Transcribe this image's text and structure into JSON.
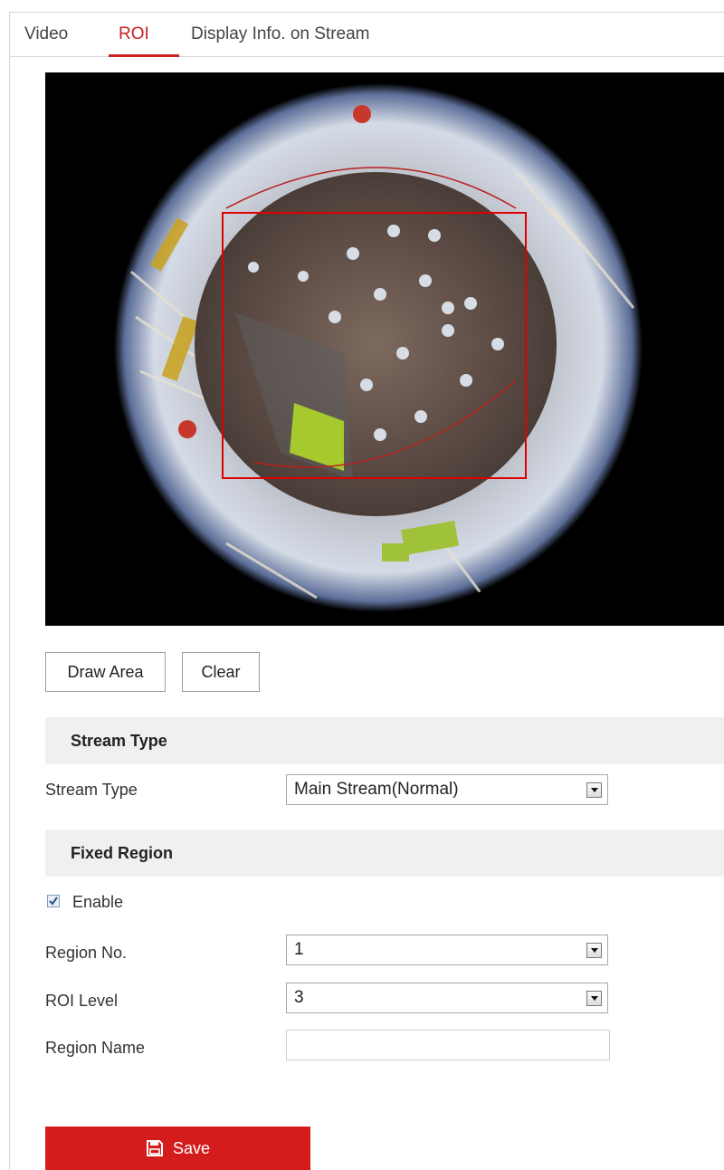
{
  "tabs": [
    {
      "label": "Video",
      "active": false
    },
    {
      "label": "ROI",
      "active": true
    },
    {
      "label": "Display Info. on Stream",
      "active": false
    }
  ],
  "accent_color": "#cc1f1f",
  "video": {
    "roi_rectangle_color": "#e00000"
  },
  "buttons": {
    "draw_area": "Draw Area",
    "clear": "Clear"
  },
  "stream_type_section": {
    "header": "Stream Type",
    "stream_type_label": "Stream Type",
    "stream_type_value": "Main Stream(Normal)"
  },
  "fixed_region_section": {
    "header": "Fixed Region",
    "enable_label": "Enable",
    "enable_checked": true,
    "region_no_label": "Region No.",
    "region_no_value": "1",
    "roi_level_label": "ROI Level",
    "roi_level_value": "3",
    "region_name_label": "Region Name",
    "region_name_value": ""
  },
  "save": {
    "label": "Save",
    "icon": "floppy-disk-icon",
    "color": "#d51c1c"
  }
}
